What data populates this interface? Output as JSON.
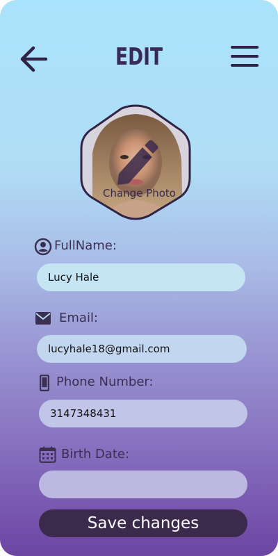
{
  "header": {
    "title": "EDIT",
    "back_icon": "arrow-left-icon",
    "menu_icon": "hamburger-menu-icon"
  },
  "profile": {
    "change_photo_label": "Change Photo",
    "edit_icon": "pencil-icon"
  },
  "form": {
    "fullname": {
      "label": "FullName:",
      "value": "Lucy Hale",
      "icon": "user-circle-icon"
    },
    "email": {
      "label": "Email:",
      "value": "lucyhale18@gmail.com",
      "icon": "envelope-icon"
    },
    "phone": {
      "label": "Phone Number:",
      "value": "3147348431",
      "icon": "smartphone-icon"
    },
    "birthdate": {
      "label": "Birth Date:",
      "value": "",
      "icon": "calendar-icon"
    }
  },
  "actions": {
    "save_label": "Save changes"
  },
  "colors": {
    "primary_dark": "#3b2a4c",
    "text_dark": "#3b2f52",
    "gradient_top": "#a9e3fb",
    "gradient_bottom": "#6c45a3"
  }
}
